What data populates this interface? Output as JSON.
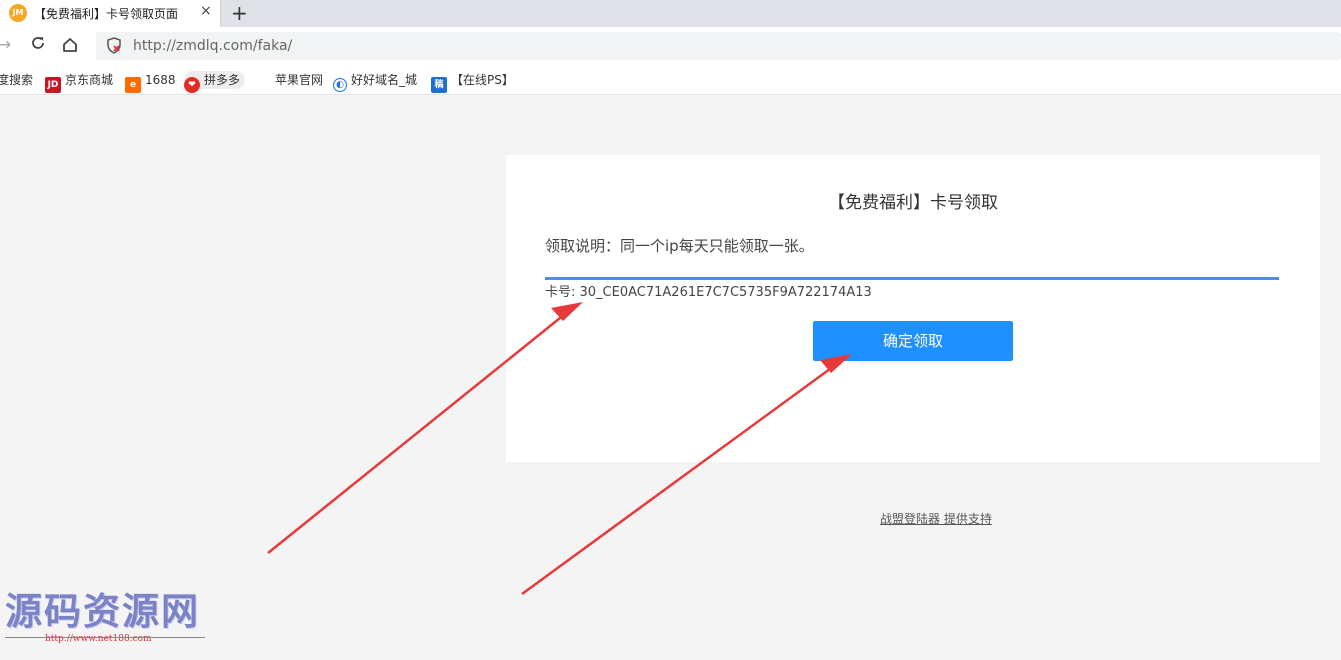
{
  "browser": {
    "tab": {
      "title": "【免费福利】卡号领取页面",
      "close": "×",
      "favicon": "JM"
    },
    "new_tab": "+",
    "url": "http://zmdlq.com/faka/",
    "bookmarks": [
      {
        "label": "度搜索",
        "icon": ""
      },
      {
        "label": "京东商城",
        "icon": "JD"
      },
      {
        "label": "1688",
        "icon": "e"
      },
      {
        "label": "拼多多",
        "icon": ""
      },
      {
        "label": "苹果官网",
        "icon": ""
      },
      {
        "label": "好好域名_城",
        "icon": ""
      },
      {
        "label": "【在线PS】",
        "icon": "稿"
      }
    ]
  },
  "page": {
    "title": "【免费福利】卡号领取",
    "notice": "领取说明：同一个ip每天只能领取一张。",
    "code_output": "卡号: 30_CE0AC71A261E7C7C5735F9A722174A13",
    "submit_label": "确定领取",
    "footer_link": "战盟登陆器 提供支持"
  },
  "watermark": {
    "title": "源码资源网",
    "url": "http://www.net188.com"
  },
  "colors": {
    "accent": "#1e90ff",
    "input_underline": "#4a90e2",
    "annotation_arrow": "#e8393a"
  }
}
